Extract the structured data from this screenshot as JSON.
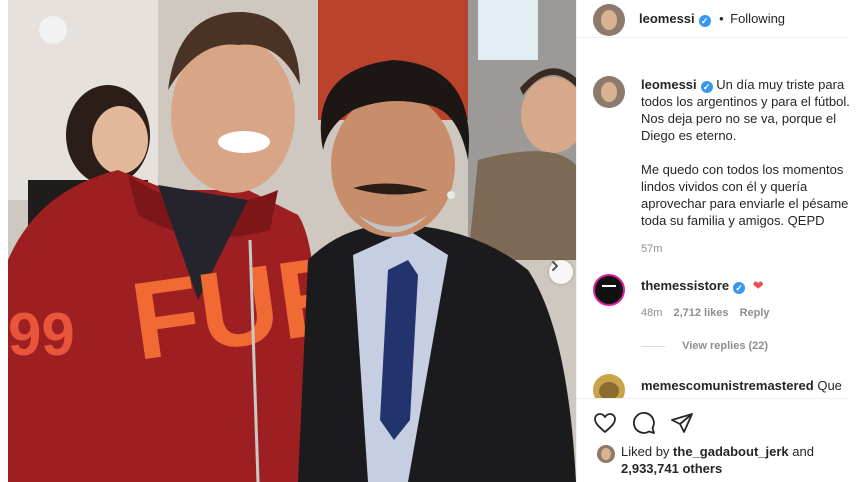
{
  "post": {
    "author": "leomessi",
    "follow_separator": "•",
    "follow_status": "Following"
  },
  "caption": {
    "author": "leomessi",
    "lines": [
      "Un día muy triste para",
      "todos los argentinos y para el fútbol.",
      "Nos deja pero no se va, porque el",
      "Diego es eterno.",
      "Me quedo con todos los momentos",
      "lindos vividos con él y quería",
      "aprovechar para enviarle el pésame a",
      "toda su familia y amigos. QEPD"
    ],
    "time": "57m"
  },
  "comments": [
    {
      "author": "themessistore",
      "text": "❤",
      "time": "48m",
      "likes": "2,712 likes",
      "reply_label": "Reply",
      "view_replies": "View replies (22)"
    },
    {
      "author": "memescomunistremastered",
      "text": "Que"
    }
  ],
  "likes": {
    "prefix": "Liked by",
    "user": "the_gadabout_jerk",
    "conjunction": "and",
    "count": "2,933,741 others"
  },
  "icons": {
    "like": "heart-outline-icon",
    "comment": "comment-bubble-icon",
    "share": "paper-plane-icon",
    "verified": "verified-badge-icon",
    "next": "chevron-right-icon"
  },
  "colors": {
    "verified_blue": "#3897f0",
    "heart_red": "#ed4956",
    "muted_text": "#8e8e8e",
    "border": "#efefef"
  }
}
